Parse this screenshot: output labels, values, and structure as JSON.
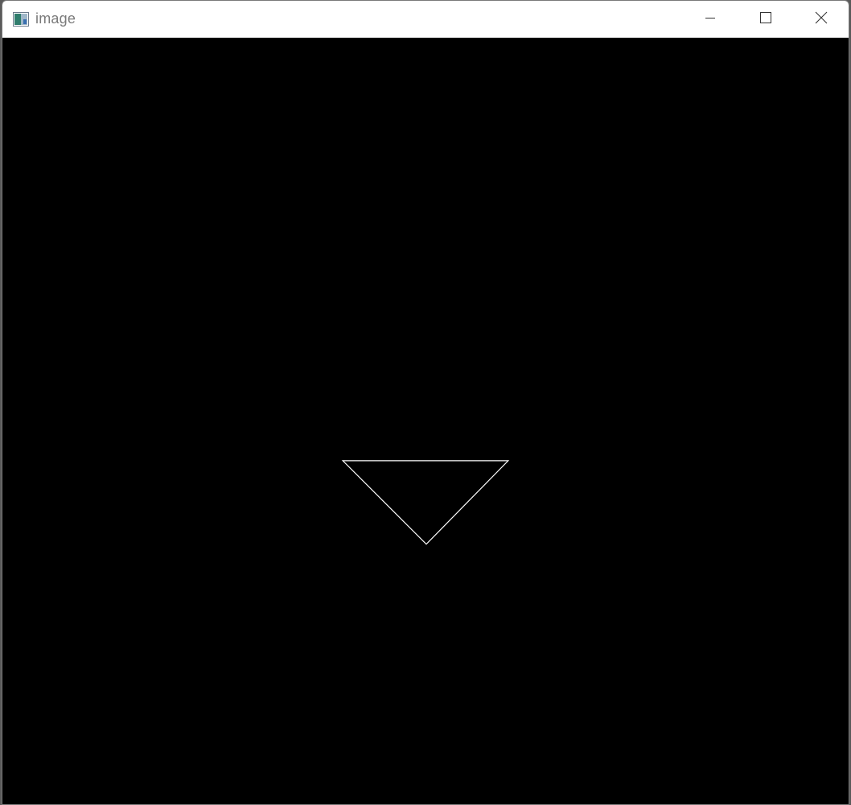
{
  "window": {
    "title": "image",
    "app_icon": "image-window-icon",
    "controls": {
      "minimize_icon": "minimize-icon",
      "maximize_icon": "maximize-icon",
      "close_icon": "close-icon"
    }
  },
  "canvas": {
    "background_color": "#000000",
    "shape": {
      "type": "inverted-triangle-outline",
      "stroke_color": "#ffffff"
    }
  },
  "colors": {
    "titlebar": "#ffffff",
    "title_text": "#7a7a7a",
    "window_border": "#7a7a7a"
  }
}
